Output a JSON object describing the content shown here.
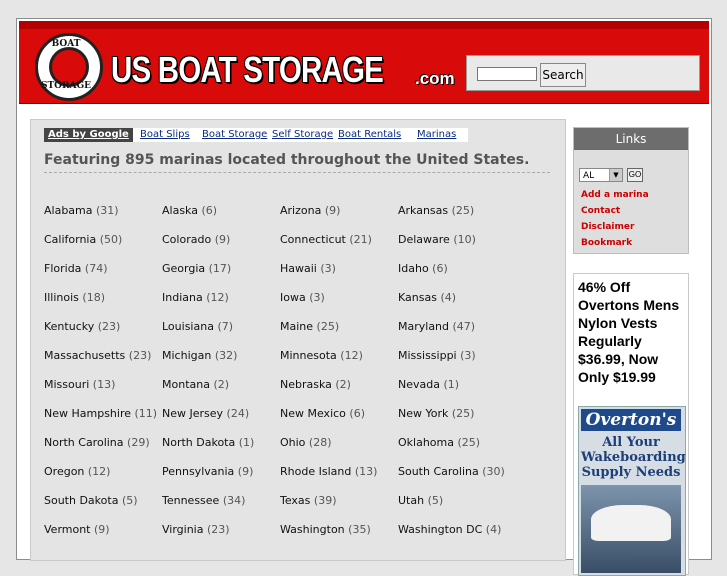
{
  "header": {
    "logo_top": "BOAT",
    "logo_bottom": "STORAGE",
    "title": "US BOAT STORAGE",
    "tld": ".com",
    "search_button": "Search",
    "search_placeholder": ""
  },
  "adbar": {
    "label": "Ads by Google",
    "links": [
      "Boat Slips",
      "Boat Storage",
      "Self Storage",
      "Boat Rentals",
      "Marinas"
    ]
  },
  "headline": "Featuring 895 marinas located throughout the United States.",
  "states": [
    {
      "name": "Alabama",
      "count": "(31)"
    },
    {
      "name": "Alaska",
      "count": "(6)"
    },
    {
      "name": "Arizona",
      "count": "(9)"
    },
    {
      "name": "Arkansas",
      "count": "(25)"
    },
    {
      "name": "California",
      "count": "(50)"
    },
    {
      "name": "Colorado",
      "count": "(9)"
    },
    {
      "name": "Connecticut",
      "count": "(21)"
    },
    {
      "name": "Delaware",
      "count": "(10)"
    },
    {
      "name": "Florida",
      "count": "(74)"
    },
    {
      "name": "Georgia",
      "count": "(17)"
    },
    {
      "name": "Hawaii",
      "count": "(3)"
    },
    {
      "name": "Idaho",
      "count": "(6)"
    },
    {
      "name": "Illinois",
      "count": "(18)"
    },
    {
      "name": "Indiana",
      "count": "(12)"
    },
    {
      "name": "Iowa",
      "count": "(3)"
    },
    {
      "name": "Kansas",
      "count": "(4)"
    },
    {
      "name": "Kentucky",
      "count": "(23)"
    },
    {
      "name": "Louisiana",
      "count": "(7)"
    },
    {
      "name": "Maine",
      "count": "(25)"
    },
    {
      "name": "Maryland",
      "count": "(47)"
    },
    {
      "name": "Massachusetts",
      "count": "(23)"
    },
    {
      "name": "Michigan",
      "count": "(32)"
    },
    {
      "name": "Minnesota",
      "count": "(12)"
    },
    {
      "name": "Mississippi",
      "count": "(3)"
    },
    {
      "name": "Missouri",
      "count": "(13)"
    },
    {
      "name": "Montana",
      "count": "(2)"
    },
    {
      "name": "Nebraska",
      "count": "(2)"
    },
    {
      "name": "Nevada",
      "count": "(1)"
    },
    {
      "name": "New Hampshire",
      "count": "(11)"
    },
    {
      "name": "New Jersey",
      "count": "(24)"
    },
    {
      "name": "New Mexico",
      "count": "(6)"
    },
    {
      "name": "New York",
      "count": "(25)"
    },
    {
      "name": "North Carolina",
      "count": "(29)"
    },
    {
      "name": "North Dakota",
      "count": "(1)"
    },
    {
      "name": "Ohio",
      "count": "(28)"
    },
    {
      "name": "Oklahoma",
      "count": "(25)"
    },
    {
      "name": "Oregon",
      "count": "(12)"
    },
    {
      "name": "Pennsylvania",
      "count": "(9)"
    },
    {
      "name": "Rhode Island",
      "count": "(13)"
    },
    {
      "name": "South Carolina",
      "count": "(30)"
    },
    {
      "name": "South Dakota",
      "count": "(5)"
    },
    {
      "name": "Tennessee",
      "count": "(34)"
    },
    {
      "name": "Texas",
      "count": "(39)"
    },
    {
      "name": "Utah",
      "count": "(5)"
    },
    {
      "name": "Vermont",
      "count": "(9)"
    },
    {
      "name": "Virginia",
      "count": "(23)"
    },
    {
      "name": "Washington",
      "count": "(35)"
    },
    {
      "name": "Washington DC",
      "count": "(4)"
    }
  ],
  "sidebar": {
    "title": "Links",
    "state_value": "AL",
    "go_label": "GO",
    "links": [
      "Add a marina",
      "Contact",
      "Disclaimer",
      "Bookmark"
    ]
  },
  "promo": {
    "text": "46% Off Overtons Mens Nylon Vests Regularly $36.99, Now Only $19.99",
    "logo": "Overton's",
    "caption": "All Your Wakeboarding Supply Needs"
  },
  "colors": {
    "header_red": "#d80a0a",
    "link_red": "#cc0000",
    "link_blue": "#0b2a84"
  }
}
